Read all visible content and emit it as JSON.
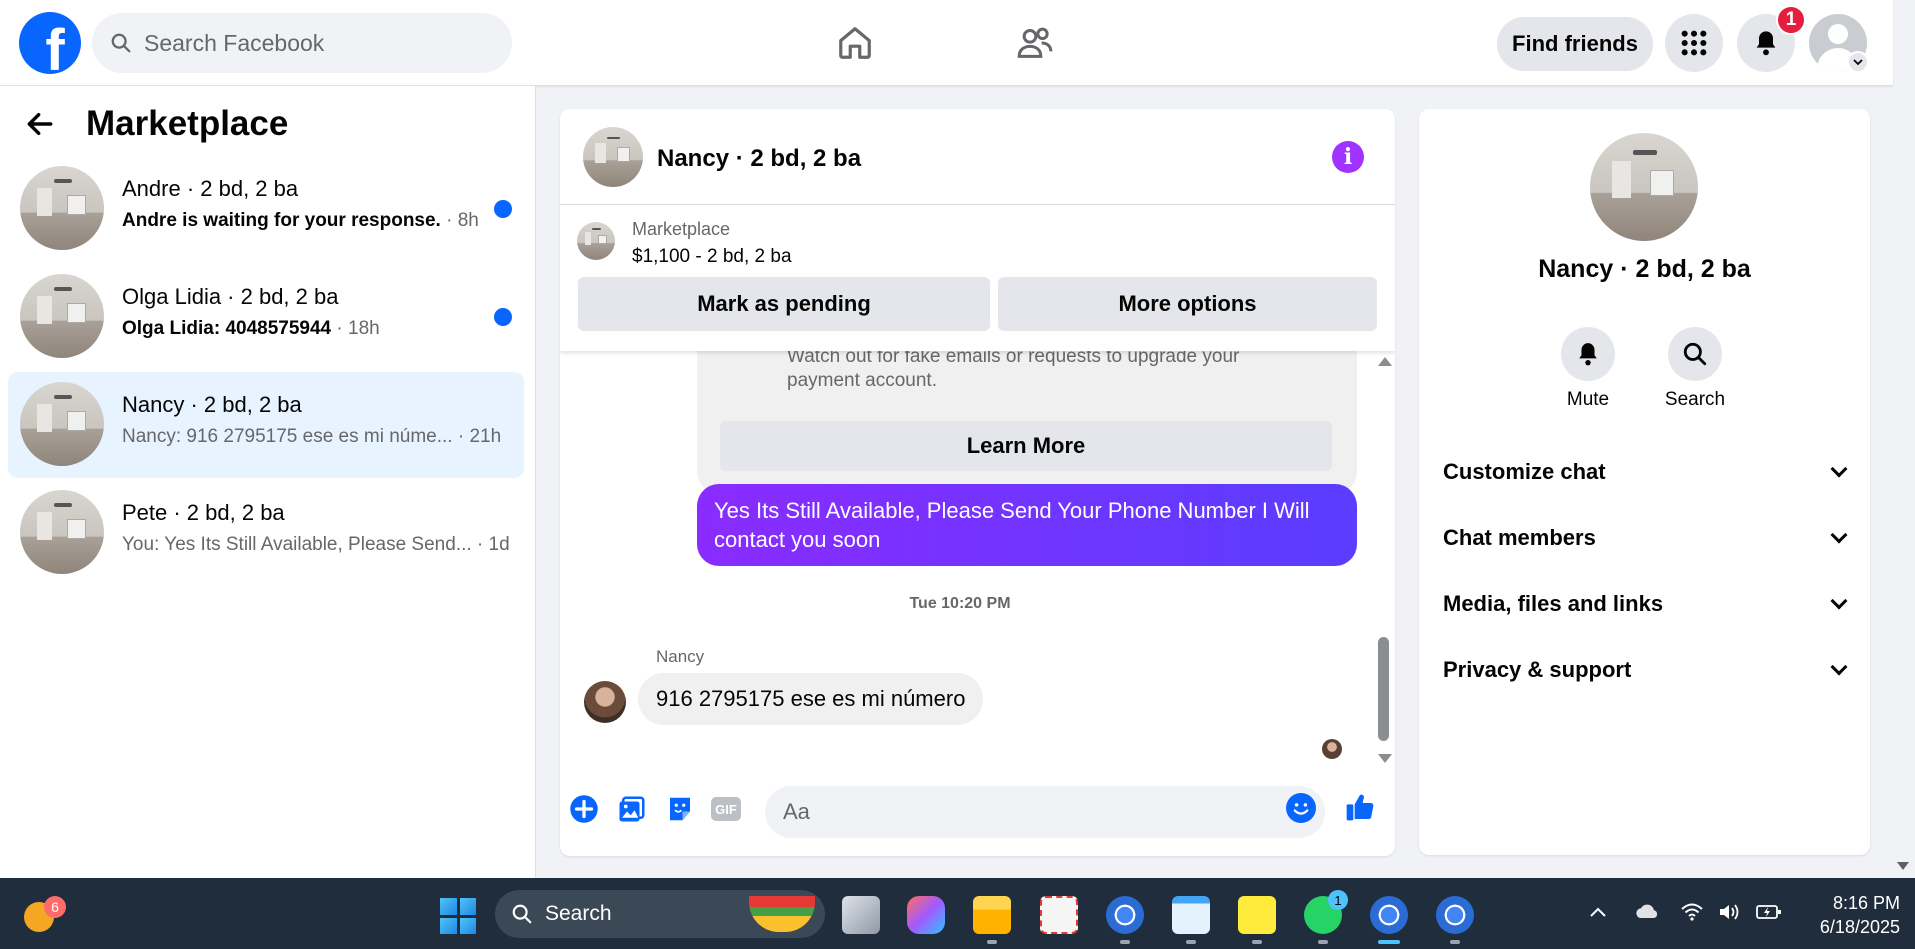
{
  "topbar": {
    "logo_letter": "f",
    "search_placeholder": "Search Facebook",
    "find_friends_label": "Find friends",
    "notification_count": "1"
  },
  "left_panel": {
    "title": "Marketplace",
    "conversations": [
      {
        "name": "Andre · 2 bd, 2 ba",
        "preview": "Andre is waiting for your response.",
        "time": " · 8h",
        "unread": true
      },
      {
        "name": "Olga Lidia · 2 bd, 2 ba",
        "preview": "Olga Lidia: 4048575944",
        "time": " · 18h",
        "unread": true
      },
      {
        "name": "Nancy · 2 bd, 2 ba",
        "preview": "Nancy: 916 2795175 ese es mi núme...",
        "time": " · 21h",
        "unread": false,
        "active": true
      },
      {
        "name": "Pete · 2 bd, 2 ba",
        "preview": "You: Yes Its Still Available, Please Send...",
        "time": " · 1d",
        "unread": false
      }
    ]
  },
  "chat": {
    "title": "Nancy · 2 bd, 2 ba",
    "marketplace_label": "Marketplace",
    "listing": "$1,100 - 2 bd, 2 ba",
    "mark_pending_label": "Mark as pending",
    "more_options_label": "More options",
    "warning_text": "Watch out for fake emails or requests to upgrade your payment account.",
    "learn_more_label": "Learn More",
    "sent_message": "Yes Its Still Available, Please Send Your Phone Number I Will contact you soon",
    "timestamp": "Tue 10:20 PM",
    "sender_name": "Nancy",
    "received_message": "916 2795175 ese es mi número",
    "composer_placeholder": "Aa",
    "gif_label": "GIF"
  },
  "right_panel": {
    "name": "Nancy · 2 bd, 2 ba",
    "mute_label": "Mute",
    "search_label": "Search",
    "sections": [
      "Customize chat",
      "Chat members",
      "Media, files and links",
      "Privacy & support"
    ]
  },
  "taskbar": {
    "weather_badge": "6",
    "search_label": "Search",
    "whatsapp_badge": "1",
    "time": "8:16 PM",
    "date": "6/18/2025"
  },
  "colors": {
    "brand_blue": "#0866ff",
    "sent_bubble": "#7b2fff",
    "info_purple": "#a033ff",
    "badge_red": "#e41e3f"
  }
}
